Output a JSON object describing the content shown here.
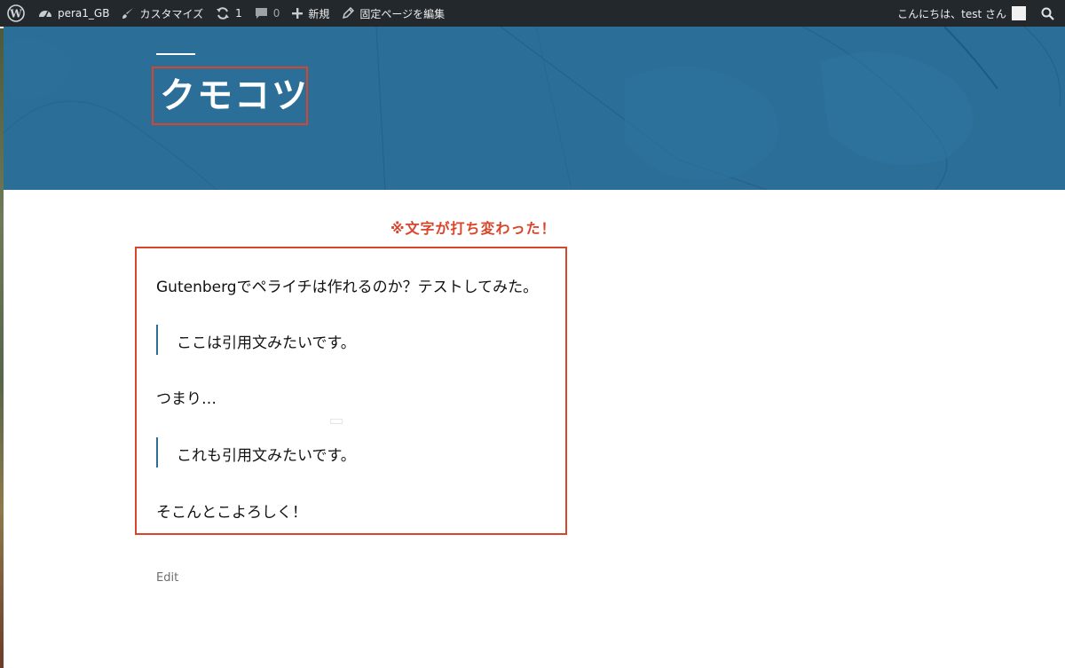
{
  "admin_bar": {
    "site_name": "pera1_GB",
    "customize": "カスタマイズ",
    "updates_count": "1",
    "comments_count": "0",
    "new_label": "新規",
    "edit_page": "固定ページを編集",
    "greeting": "こんにちは、test さん"
  },
  "header": {
    "site_title": "クモコツ",
    "background_color": "#2b6f98"
  },
  "annotation": {
    "text": "※文字が打ち変わった！",
    "color": "#d9452b"
  },
  "content": {
    "para1": "Gutenbergでペライチは作れるのか？テストしてみた。",
    "quote1": "ここは引用文みたいです。",
    "para2": "つまり…",
    "quote2": "これも引用文みたいです。",
    "para3": "そこんとこよろしく！"
  },
  "footer": {
    "edit_label": "Edit"
  }
}
